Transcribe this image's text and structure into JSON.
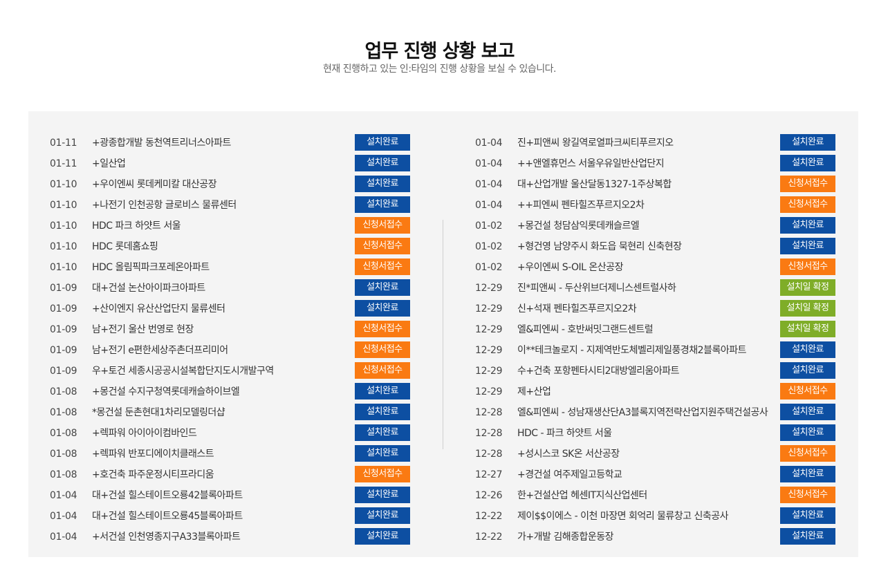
{
  "header": {
    "title": "업무 진행 상황 보고",
    "subtitle": "현재 진행하고 있는 인:타임의 진행 상황을 보실 수 있습니다."
  },
  "status_colors": {
    "done": "#0d4fa2",
    "received": "#fa7a12",
    "confirmed": "#7fad28"
  },
  "left_items": [
    {
      "date": "01-11",
      "title": "+광종합개발 동천역트리너스아파트",
      "status": "설치완료",
      "type": "done"
    },
    {
      "date": "01-11",
      "title": "+일산업",
      "status": "설치완료",
      "type": "done"
    },
    {
      "date": "01-10",
      "title": "+우이엔씨 롯데케미칼 대산공장",
      "status": "설치완료",
      "type": "done"
    },
    {
      "date": "01-10",
      "title": "+나전기 인천공항 글로비스 물류센터",
      "status": "설치완료",
      "type": "done"
    },
    {
      "date": "01-10",
      "title": "HDC 파크 하얏트 서울",
      "status": "신청서접수",
      "type": "received"
    },
    {
      "date": "01-10",
      "title": "HDC 롯데홈쇼핑",
      "status": "신청서접수",
      "type": "received"
    },
    {
      "date": "01-10",
      "title": "HDC 올림픽파크포레온아파트",
      "status": "신청서접수",
      "type": "received"
    },
    {
      "date": "01-09",
      "title": "대+건설 논산아이파크아파트",
      "status": "설치완료",
      "type": "done"
    },
    {
      "date": "01-09",
      "title": "+산이엔지 유산산업단지 물류센터",
      "status": "설치완료",
      "type": "done"
    },
    {
      "date": "01-09",
      "title": "남+전기 울산 번영로 현장",
      "status": "신청서접수",
      "type": "received"
    },
    {
      "date": "01-09",
      "title": "남+전기 e편한세상주촌더프리미어",
      "status": "신청서접수",
      "type": "received"
    },
    {
      "date": "01-09",
      "title": "우+토건 세종시공공시설복합단지도시개발구역",
      "status": "신청서접수",
      "type": "received"
    },
    {
      "date": "01-08",
      "title": "+몽건설 수지구청역롯데캐슬하이브엘",
      "status": "설치완료",
      "type": "done"
    },
    {
      "date": "01-08",
      "title": "*몽건설 둔촌현대1차리모델링더샵",
      "status": "설치완료",
      "type": "done"
    },
    {
      "date": "01-08",
      "title": "+렉파워 아이아이컴바인드",
      "status": "설치완료",
      "type": "done"
    },
    {
      "date": "01-08",
      "title": "+렉파워 반포디에이치클래스트",
      "status": "설치완료",
      "type": "done"
    },
    {
      "date": "01-08",
      "title": "+호건축 파주운정시티프라디움",
      "status": "신청서접수",
      "type": "received"
    },
    {
      "date": "01-04",
      "title": "대+건설 힐스테이트오룡42블록아파트",
      "status": "설치완료",
      "type": "done"
    },
    {
      "date": "01-04",
      "title": "대+건설 힐스테이트오룡45블록아파트",
      "status": "설치완료",
      "type": "done"
    },
    {
      "date": "01-04",
      "title": "+서건설 인천영종지구A33블록아파트",
      "status": "설치완료",
      "type": "done"
    }
  ],
  "right_items": [
    {
      "date": "01-04",
      "title": "진+피앤씨 왕길역로열파크씨티푸르지오",
      "status": "설치완료",
      "type": "done"
    },
    {
      "date": "01-04",
      "title": "++앤엘휴먼스 서울우유일반산업단지",
      "status": "설치완료",
      "type": "done"
    },
    {
      "date": "01-04",
      "title": "대+산업개발 울산달동1327-1주상복합",
      "status": "신청서접수",
      "type": "received"
    },
    {
      "date": "01-04",
      "title": "++피엔씨 펜타힐즈푸르지오2차",
      "status": "신청서접수",
      "type": "received"
    },
    {
      "date": "01-02",
      "title": "+몽건설 청담삼익롯데캐슬르엘",
      "status": "설치완료",
      "type": "done"
    },
    {
      "date": "01-02",
      "title": "+형건영 남양주시 화도읍 묵현리 신축현장",
      "status": "설치완료",
      "type": "done"
    },
    {
      "date": "01-02",
      "title": "+우이엔씨 S-OIL 온산공장",
      "status": "신청서접수",
      "type": "received"
    },
    {
      "date": "12-29",
      "title": "진*피앤씨 - 두산위브더제니스센트럴사하",
      "status": "설치일 확정",
      "type": "confirmed"
    },
    {
      "date": "12-29",
      "title": "신+석재 펜타힐즈푸르지오2차",
      "status": "설치일 확정",
      "type": "confirmed"
    },
    {
      "date": "12-29",
      "title": "엘&피엔씨 - 호반써밋그랜드센트럴",
      "status": "설치일 확정",
      "type": "confirmed"
    },
    {
      "date": "12-29",
      "title": "이**테크놀로지 - 지제역반도체벨리제일풍경채2블록아파트",
      "status": "설치완료",
      "type": "done"
    },
    {
      "date": "12-29",
      "title": "수+건축 포항펜타시티2대방엘리움아파트",
      "status": "설치완료",
      "type": "done"
    },
    {
      "date": "12-29",
      "title": "제+산업",
      "status": "신청서접수",
      "type": "received"
    },
    {
      "date": "12-28",
      "title": "엘&피엔씨 - 성남재생산단A3블록지역전략산업지원주택건설공사",
      "status": "설치완료",
      "type": "done"
    },
    {
      "date": "12-28",
      "title": "HDC - 파크 하얏트 서울",
      "status": "설치완료",
      "type": "done"
    },
    {
      "date": "12-28",
      "title": "+성시스코 SK온 서산공장",
      "status": "신청서접수",
      "type": "received"
    },
    {
      "date": "12-27",
      "title": "+경건설 여주제일고등학교",
      "status": "설치완료",
      "type": "done"
    },
    {
      "date": "12-26",
      "title": "한+건설산업 헤센IT지식산업센터",
      "status": "신청서접수",
      "type": "received"
    },
    {
      "date": "12-22",
      "title": "제이$$이에스 - 이천 마장면 회억리 물류창고 신축공사",
      "status": "설치완료",
      "type": "done"
    },
    {
      "date": "12-22",
      "title": "가+개발 김해종합운동장",
      "status": "설치완료",
      "type": "done"
    }
  ]
}
